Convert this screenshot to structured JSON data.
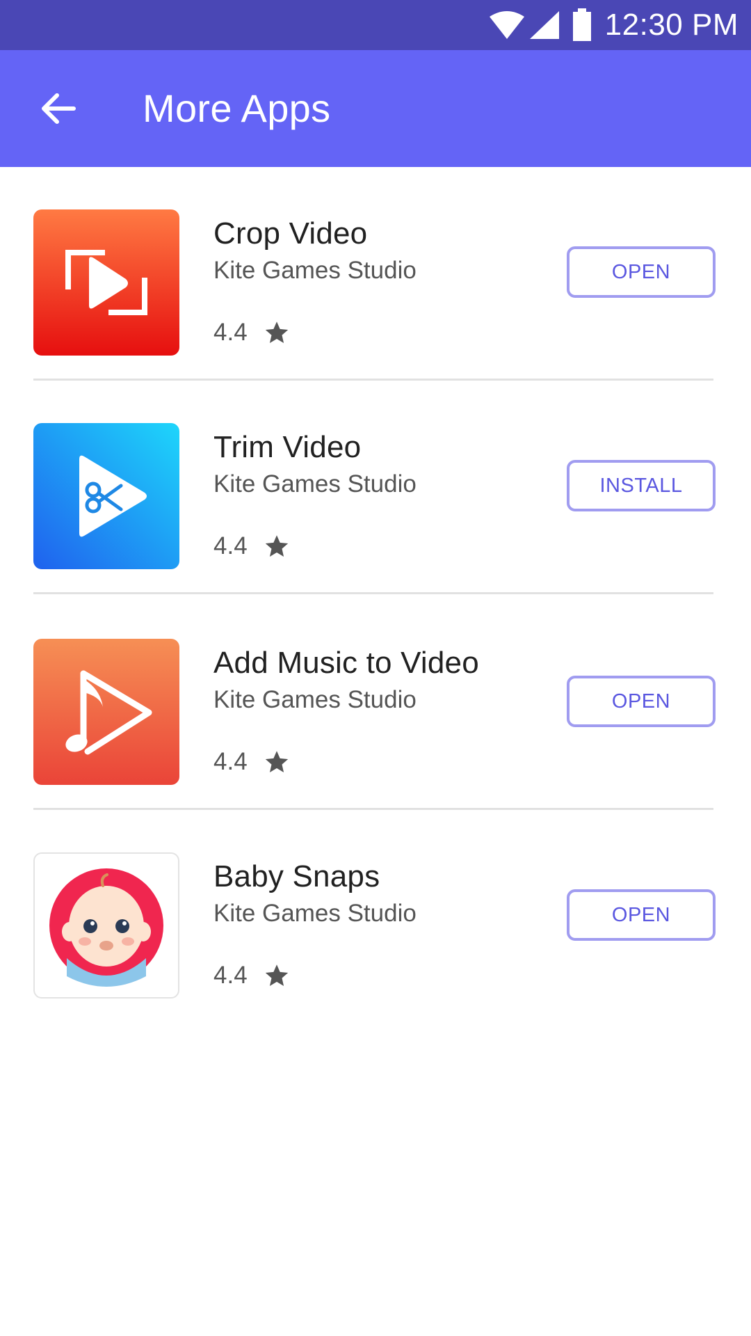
{
  "status_bar": {
    "time": "12:30 PM",
    "icons": [
      "wifi-icon",
      "cellular-signal-icon",
      "battery-icon"
    ]
  },
  "app_bar": {
    "back_icon": "arrow-left-icon",
    "title": "More Apps",
    "background": "#6464f6",
    "status_background": "#4a47b5"
  },
  "apps": [
    {
      "name": "Crop Video",
      "developer": "Kite Games Studio",
      "rating": "4.4",
      "action": "OPEN",
      "icon": "crop-video-icon"
    },
    {
      "name": "Trim Video",
      "developer": "Kite Games Studio",
      "rating": "4.4",
      "action": "INSTALL",
      "icon": "trim-video-icon"
    },
    {
      "name": "Add Music to Video",
      "developer": "Kite Games Studio",
      "rating": "4.4",
      "action": "OPEN",
      "icon": "add-music-icon"
    },
    {
      "name": "Baby Snaps",
      "developer": "Kite Games Studio",
      "rating": "4.4",
      "action": "OPEN",
      "icon": "baby-face-icon"
    }
  ],
  "colors": {
    "accent": "#5a57e0",
    "button_border": "#a09cf0",
    "star": "#555555"
  }
}
